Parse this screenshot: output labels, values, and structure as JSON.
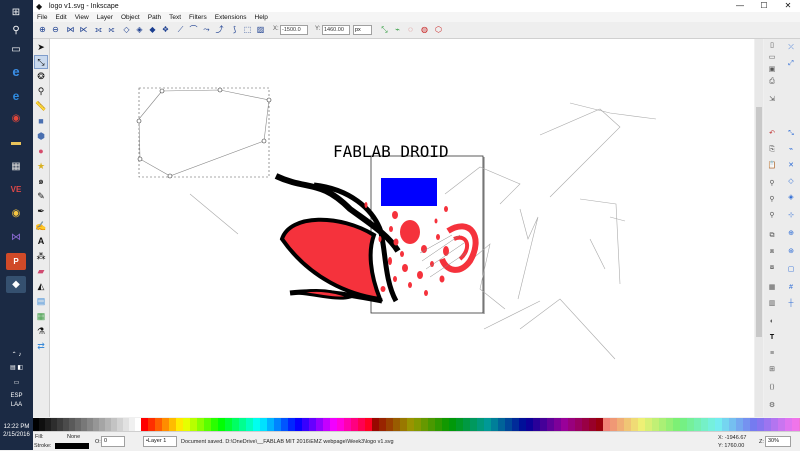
{
  "window": {
    "title": "logo v1.svg - Inkscape"
  },
  "menu": [
    "File",
    "Edit",
    "View",
    "Layer",
    "Object",
    "Path",
    "Text",
    "Filters",
    "Extensions",
    "Help"
  ],
  "toolbar": {
    "x_label": "X:",
    "x_value": "-1500.0",
    "y_label": "Y:",
    "y_value": "1460.00",
    "unit": "px"
  },
  "canvas": {
    "text": "FABLAB DROID"
  },
  "taskbar": {
    "time": "12:22 PM",
    "date": "2/15/2016",
    "lang1": "ESP",
    "lang2": "LAA"
  },
  "status": {
    "fill_label": "Fill:",
    "fill_value": "None",
    "stroke_label": "Stroke:",
    "opacity_label": "O:",
    "opacity_value": "0",
    "layer": "•Layer 1",
    "message": "Document saved. D:\\OneDrive\\__FABLAB MIT 2016\\EMZ webpage\\Week3\\logo v1.svg",
    "x_coord": "X: -1946.67",
    "y_coord": "Y:  1760.00",
    "zoom_label": "Z:",
    "zoom": "30%"
  },
  "colors": {
    "accent_red": "#f5323c",
    "accent_blue": "#0000ff",
    "taskbar_bg": "#1b2a44"
  }
}
